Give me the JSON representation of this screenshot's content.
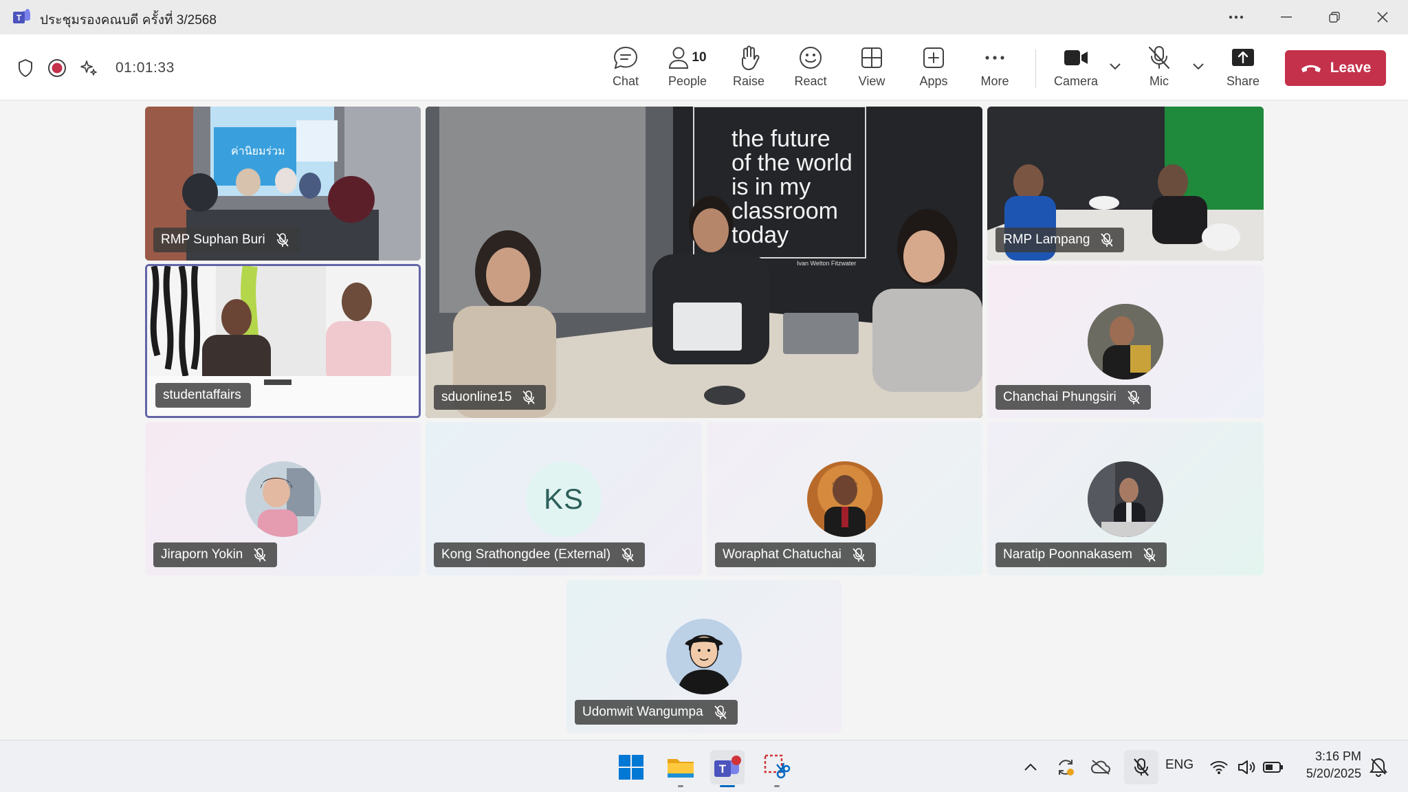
{
  "window": {
    "title": "ประชุมรองคณบดี ครั้งที่ 3/2568"
  },
  "toolbar": {
    "timer": "01:01:33",
    "buttons": {
      "chat": "Chat",
      "people": "People",
      "people_count": "10",
      "raise": "Raise",
      "react": "React",
      "view": "View",
      "apps": "Apps",
      "more": "More",
      "camera": "Camera",
      "mic": "Mic",
      "share": "Share",
      "leave": "Leave"
    }
  },
  "participants": [
    {
      "name": "RMP Suphan Buri",
      "muted": true,
      "type": "video"
    },
    {
      "name": "sduonline15",
      "muted": true,
      "type": "video",
      "pinned_large": true
    },
    {
      "name": "RMP Lampang",
      "muted": true,
      "type": "video"
    },
    {
      "name": "studentaffairs",
      "muted": false,
      "type": "video",
      "selected": true
    },
    {
      "name": "Chanchai Phungsiri",
      "muted": true,
      "type": "photo"
    },
    {
      "name": "Jiraporn Yokin",
      "muted": true,
      "type": "photo"
    },
    {
      "name": "Kong Srathongdee (External)",
      "muted": true,
      "type": "initials",
      "initials": "KS"
    },
    {
      "name": "Woraphat Chatuchai",
      "muted": true,
      "type": "photo"
    },
    {
      "name": "Naratip Poonnakasem",
      "muted": true,
      "type": "photo"
    },
    {
      "name": "Udomwit Wangumpa",
      "muted": true,
      "type": "cartoon"
    }
  ],
  "video_overlay": {
    "quote": [
      "the future",
      "of the world",
      "is in my",
      "classroom",
      "today"
    ],
    "quote_author": "Ivan Welton Fitzwater",
    "banner_text": "ค่านิยมร่วม"
  },
  "taskbar": {
    "language": "ENG",
    "time": "3:16 PM",
    "date": "5/20/2025"
  },
  "colors": {
    "accent": "#6264a7",
    "leave": "#c4314b",
    "toolbar_bg": "#ffffff",
    "titlebar_bg": "#ebebeb"
  }
}
